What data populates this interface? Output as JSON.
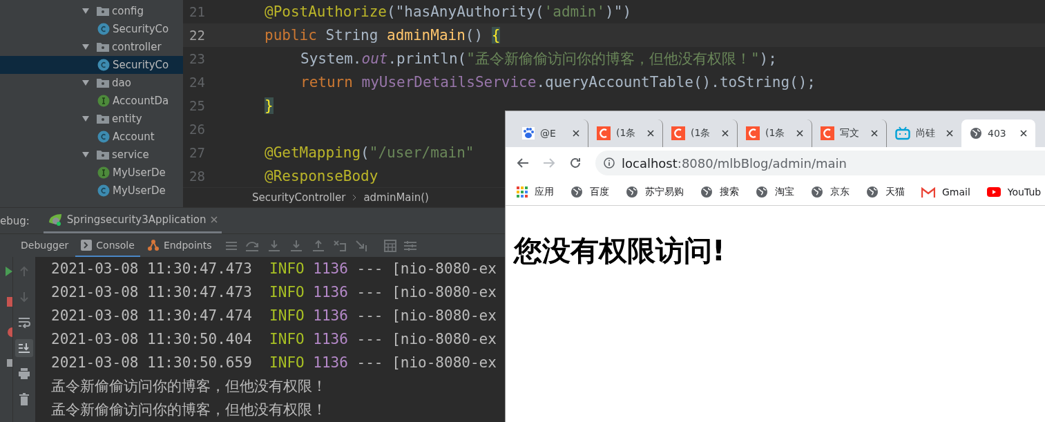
{
  "project_tree": [
    {
      "label": "config",
      "kind": "folder",
      "expanded": true,
      "selected": false,
      "children": [
        {
          "label": "SecurityCo",
          "kind": "class",
          "selected": false
        }
      ]
    },
    {
      "label": "controller",
      "kind": "folder",
      "expanded": true,
      "selected": false,
      "children": [
        {
          "label": "SecurityCo",
          "kind": "class",
          "selected": true
        }
      ]
    },
    {
      "label": "dao",
      "kind": "folder",
      "expanded": true,
      "selected": false,
      "children": [
        {
          "label": "AccountDa",
          "kind": "interface",
          "selected": false
        }
      ]
    },
    {
      "label": "entity",
      "kind": "folder",
      "expanded": true,
      "selected": false,
      "children": [
        {
          "label": "Account",
          "kind": "class",
          "selected": false
        }
      ]
    },
    {
      "label": "service",
      "kind": "folder",
      "expanded": true,
      "selected": false,
      "children": [
        {
          "label": "MyUserDe",
          "kind": "interface",
          "selected": false
        },
        {
          "label": "MyUserDe",
          "kind": "class",
          "selected": false
        }
      ]
    }
  ],
  "editor": {
    "lines": [
      {
        "number": "21",
        "current": false,
        "indented": false,
        "tokens": [
          {
            "kind": "annotation",
            "text": "@PostAuthorize"
          },
          {
            "kind": "plain",
            "text": "(\"hasAnyAuthority("
          },
          {
            "kind": "string",
            "text": "'admin'"
          },
          {
            "kind": "plain",
            "text": ")\")"
          }
        ]
      },
      {
        "number": "22",
        "current": true,
        "indented": false,
        "tokens": [
          {
            "kind": "keyword",
            "text": "public "
          },
          {
            "kind": "plain",
            "text": "String "
          },
          {
            "kind": "method",
            "text": "adminMain"
          },
          {
            "kind": "plain",
            "text": "() "
          },
          {
            "kind": "brace",
            "text": "{"
          }
        ]
      },
      {
        "number": "23",
        "current": false,
        "indented": true,
        "tokens": [
          {
            "kind": "plain",
            "text": "System."
          },
          {
            "kind": "field",
            "text": "out"
          },
          {
            "kind": "plain",
            "text": ".println("
          },
          {
            "kind": "string",
            "text": "\"孟令新偷偷访问你的博客，但他没有权限！\""
          },
          {
            "kind": "plain",
            "text": ");"
          }
        ]
      },
      {
        "number": "24",
        "current": false,
        "indented": true,
        "tokens": [
          {
            "kind": "keyword",
            "text": "return "
          },
          {
            "kind": "member",
            "text": "myUserDetailsService"
          },
          {
            "kind": "plain",
            "text": ".queryAccountTable().toString();"
          }
        ]
      },
      {
        "number": "25",
        "current": false,
        "indented": false,
        "tokens": [
          {
            "kind": "brace",
            "text": "}"
          }
        ]
      },
      {
        "number": "26"
      },
      {
        "number": "27",
        "current": false,
        "indented": false,
        "tokens": [
          {
            "kind": "annotation",
            "text": "@GetMapping"
          },
          {
            "kind": "plain",
            "text": "("
          },
          {
            "kind": "string",
            "text": "\"/user/main\""
          }
        ]
      },
      {
        "number": "28",
        "current": false,
        "indented": false,
        "tokens": [
          {
            "kind": "annotation",
            "text": "@ResponseBody"
          }
        ]
      }
    ],
    "breadcrumbs": [
      "SecurityController",
      "adminMain()"
    ]
  },
  "debug_panel": {
    "label": "ebug:",
    "session_tabs": [
      {
        "label": "Springsecurity3Application",
        "selected": true
      }
    ],
    "tool_tabs": [
      {
        "label": "Debugger",
        "kind": "debugger",
        "selected": false
      },
      {
        "label": "Console",
        "kind": "console",
        "selected": true
      },
      {
        "label": "Endpoints",
        "kind": "endpoints",
        "selected": false
      }
    ],
    "console_lines": [
      {
        "kind": "log",
        "time": "2021-03-08 11:30:47.473",
        "level": "INFO",
        "pid": "1136",
        "sep": "---",
        "thread": "[nio-8080-ex"
      },
      {
        "kind": "log",
        "time": "2021-03-08 11:30:47.473",
        "level": "INFO",
        "pid": "1136",
        "sep": "---",
        "thread": "[nio-8080-ex"
      },
      {
        "kind": "log",
        "time": "2021-03-08 11:30:47.474",
        "level": "INFO",
        "pid": "1136",
        "sep": "---",
        "thread": "[nio-8080-ex"
      },
      {
        "kind": "log",
        "time": "2021-03-08 11:30:50.404",
        "level": "INFO",
        "pid": "1136",
        "sep": "---",
        "thread": "[nio-8080-ex"
      },
      {
        "kind": "log",
        "time": "2021-03-08 11:30:50.659",
        "level": "INFO",
        "pid": "1136",
        "sep": "---",
        "thread": "[nio-8080-ex"
      },
      {
        "kind": "output",
        "text": "孟令新偷偷访问你的博客，但他没有权限！"
      },
      {
        "kind": "output",
        "text": "孟令新偷偷访问你的博客，但他没有权限！"
      }
    ]
  },
  "browser": {
    "tabs": [
      {
        "kind": "baidu",
        "label": "@E",
        "selected": false
      },
      {
        "kind": "csdn",
        "label": "(1条",
        "selected": false
      },
      {
        "kind": "csdn",
        "label": "(1条",
        "selected": false
      },
      {
        "kind": "csdn",
        "label": "(1条",
        "selected": false
      },
      {
        "kind": "csdn",
        "label": "写文",
        "selected": false
      },
      {
        "kind": "bilibili",
        "label": "尚硅",
        "selected": false
      },
      {
        "kind": "globe",
        "label": "403",
        "selected": true
      }
    ],
    "address": {
      "host": "localhost",
      "path": ":8080/mlbBlog/admin/main"
    },
    "bookmarks": [
      {
        "kind": "apps",
        "label": "应用"
      },
      {
        "kind": "globe",
        "label": "百度"
      },
      {
        "kind": "globe",
        "label": "苏宁易购"
      },
      {
        "kind": "globe",
        "label": "搜索"
      },
      {
        "kind": "globe",
        "label": "淘宝"
      },
      {
        "kind": "globe",
        "label": "京东"
      },
      {
        "kind": "globe",
        "label": "天猫"
      },
      {
        "kind": "gmail",
        "label": "Gmail"
      },
      {
        "kind": "youtube",
        "label": "YouTub"
      }
    ],
    "heading": "您没有权限访问!"
  }
}
